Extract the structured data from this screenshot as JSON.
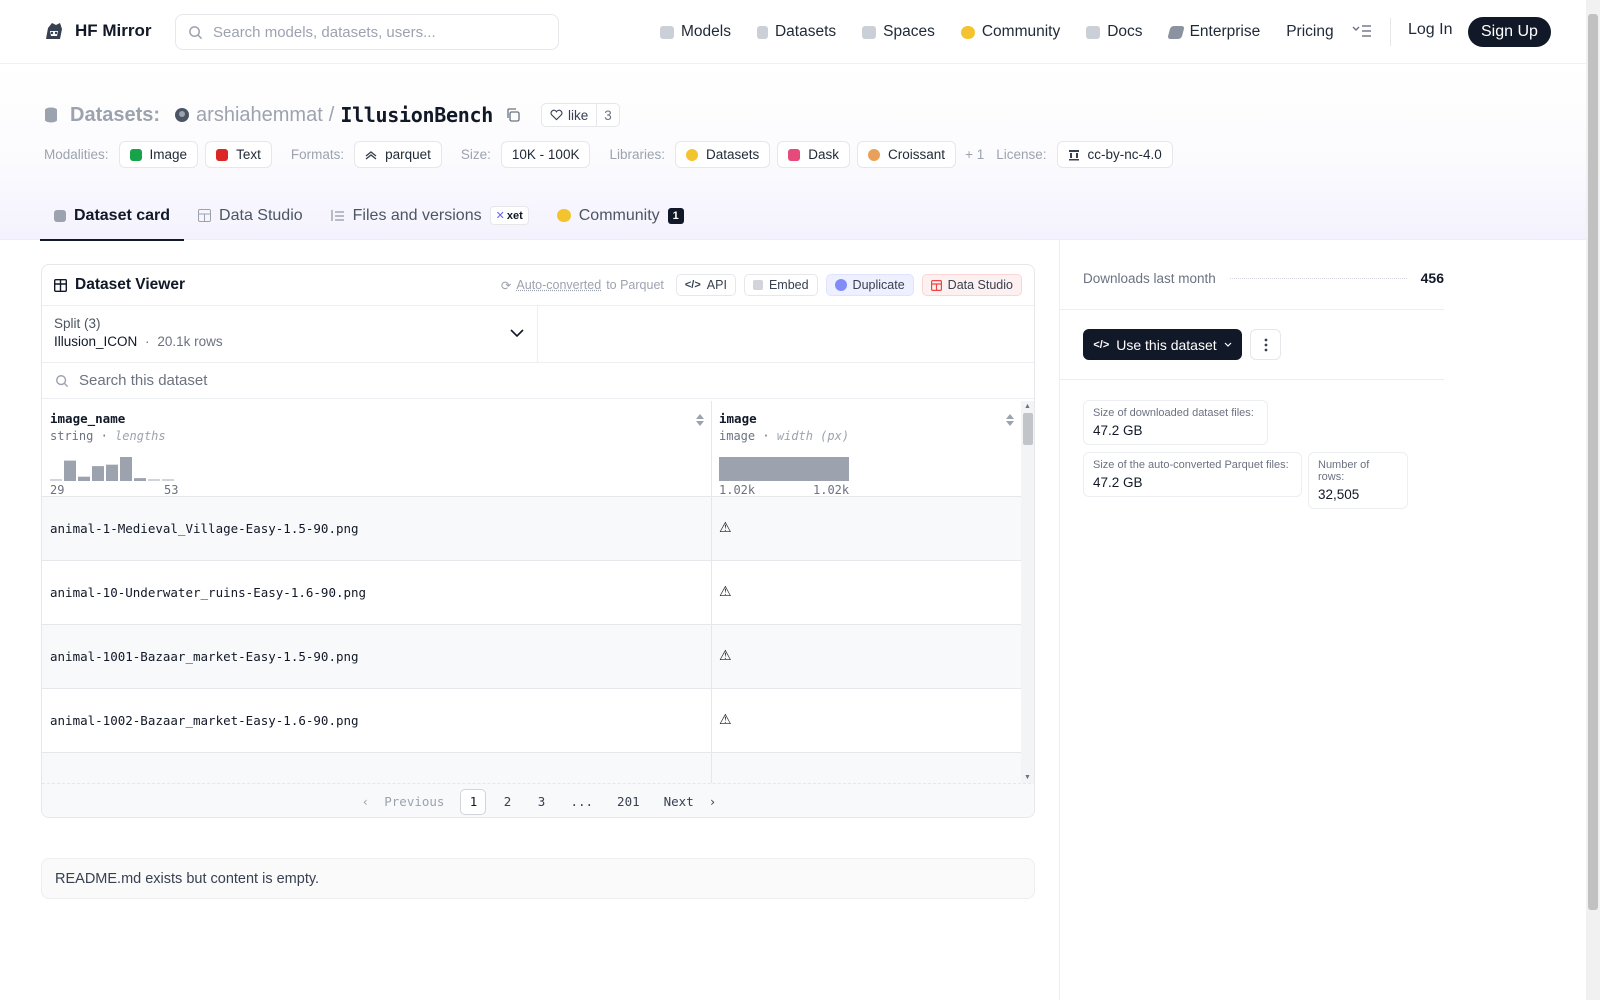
{
  "nav": {
    "brand": "HF Mirror",
    "search_placeholder": "Search models, datasets, users...",
    "links": [
      {
        "label": "Models",
        "icon": "cube-icon",
        "color": "#9ca3af"
      },
      {
        "label": "Datasets",
        "icon": "database-icon",
        "color": "#9ca3af"
      },
      {
        "label": "Spaces",
        "icon": "grid-icon",
        "color": "#9ca3af"
      },
      {
        "label": "Community",
        "icon": "community-icon",
        "color": "#f4c430"
      },
      {
        "label": "Docs",
        "icon": "book-icon",
        "color": "#9ca3af"
      },
      {
        "label": "Enterprise",
        "icon": "enterprise-icon",
        "color": "#6b7280"
      },
      {
        "label": "Pricing",
        "icon": "",
        "color": ""
      }
    ],
    "login": "Log In",
    "signup": "Sign Up"
  },
  "header": {
    "section": "Datasets:",
    "owner": "arshiahemmat",
    "separator": "/",
    "name": "IllusionBench",
    "like_label": "like",
    "like_count": "3",
    "modalities_label": "Modalities:",
    "modalities": [
      {
        "label": "Image",
        "color": "#16a34a"
      },
      {
        "label": "Text",
        "color": "#dc2626"
      }
    ],
    "formats_label": "Formats:",
    "format": "parquet",
    "size_label": "Size:",
    "size": "10K - 100K",
    "libraries_label": "Libraries:",
    "libraries": [
      {
        "label": "Datasets",
        "color": "#f4c430"
      },
      {
        "label": "Dask",
        "color": "#e64a7b"
      },
      {
        "label": "Croissant",
        "color": "#e9a15a"
      }
    ],
    "libraries_more": "+ 1",
    "license_label": "License:",
    "license": "cc-by-nc-4.0"
  },
  "tabs": [
    {
      "label": "Dataset card",
      "active": true
    },
    {
      "label": "Data Studio"
    },
    {
      "label": "Files and versions",
      "badge": "xet"
    },
    {
      "label": "Community",
      "count": "1"
    }
  ],
  "viewer": {
    "title": "Dataset Viewer",
    "auto_converted": "Auto-converted",
    "to_parquet": "to Parquet",
    "buttons": [
      "API",
      "Embed",
      "Duplicate",
      "Data Studio"
    ],
    "split_label": "Split (3)",
    "split_value": "Illusion_ICON",
    "split_rows": "20.1k rows",
    "search_placeholder": "Search this dataset",
    "columns": [
      {
        "name": "image_name",
        "type": "string",
        "stat": "lengths",
        "min": "29",
        "max": "53",
        "histogram": [
          0.08,
          0.85,
          0.18,
          0.62,
          0.68,
          1.0,
          0.12,
          0.04,
          0.04
        ]
      },
      {
        "name": "image",
        "type": "image",
        "stat": "width (px)",
        "min": "1.02k",
        "max": "1.02k",
        "histogram": [
          1.0
        ]
      }
    ],
    "rows": [
      "animal-1-Medieval_Village-Easy-1.5-90.png",
      "animal-10-Underwater_ruins-Easy-1.6-90.png",
      "animal-1001-Bazaar_market-Easy-1.5-90.png",
      "animal-1002-Bazaar_market-Easy-1.6-90.png"
    ],
    "pager": {
      "previous": "Previous",
      "pages": [
        "1",
        "2",
        "3",
        "...",
        "201"
      ],
      "current": "1",
      "next": "Next"
    }
  },
  "readme_note": "README.md exists but content is empty.",
  "sidebar": {
    "downloads_label": "Downloads last month",
    "downloads": "456",
    "use_button": "Use this dataset",
    "stats": [
      {
        "label": "Size of downloaded dataset files:",
        "value": "47.2 GB"
      },
      {
        "label": "Size of the auto-converted Parquet files:",
        "value": "47.2 GB"
      },
      {
        "label": "Number of rows:",
        "value": "32,505"
      }
    ]
  }
}
